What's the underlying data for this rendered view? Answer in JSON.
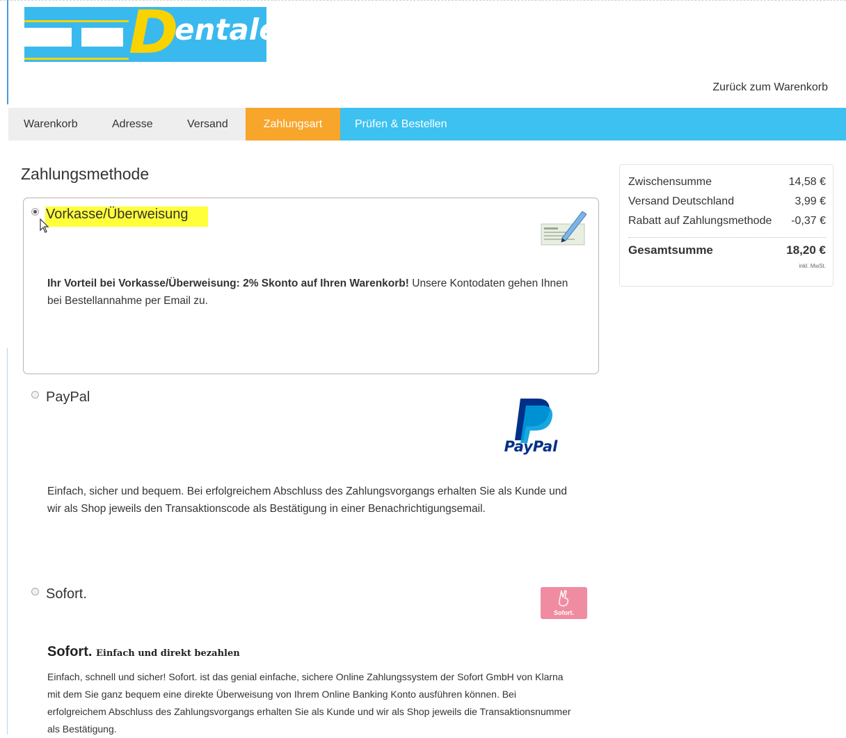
{
  "brand": {
    "logo_text": "Dentaler"
  },
  "header": {
    "back_link": "Zurück zum Warenkorb"
  },
  "steps": [
    {
      "label": "Warenkorb",
      "state": "done"
    },
    {
      "label": "Adresse",
      "state": "done"
    },
    {
      "label": "Versand",
      "state": "done"
    },
    {
      "label": "Zahlungsart",
      "state": "active"
    },
    {
      "label": "Prüfen & Bestellen",
      "state": "upcoming"
    }
  ],
  "main": {
    "heading": "Zahlungsmethode",
    "methods": [
      {
        "name": "Vorkasse/Überweisung",
        "selected": true,
        "icon": "bank-transfer-icon",
        "desc_bold": "Ihr Vorteil bei Vorkasse/Überweisung: 2% Skonto auf Ihren Warenkorb!",
        "desc": " Unsere Kontodaten gehen Ihnen bei Bestellannahme per Email zu."
      },
      {
        "name": "PayPal",
        "selected": false,
        "icon": "paypal-logo-icon",
        "logo_text": "PayPal",
        "desc": "Einfach, sicher und bequem. Bei erfolgreichem Abschluss des Zahlungsvorgangs erhalten Sie als Kunde und wir als Shop jeweils den Transaktionscode als Bestätigung in einer Benachrichtigungsemail."
      },
      {
        "name": "Sofort.",
        "selected": false,
        "icon": "sofort-logo-icon",
        "logo_text": "Sofort.",
        "title": "Sofort.",
        "subtitle": "Einfach und direkt bezahlen",
        "desc": "Einfach, schnell und sicher! Sofort. ist das genial einfache, sichere Online Zahlungssystem der Sofort GmbH von Klarna mit dem Sie ganz bequem eine direkte Überweisung von Ihrem Online Banking Konto ausführen können. Bei erfolgreichem Abschluss des Zahlungsvorgangs erhalten Sie als Kunde und wir als Shop jeweils die Transaktionsnummer als Bestätigung."
      }
    ]
  },
  "summary": {
    "rows": [
      {
        "label": "Zwischensumme",
        "value": "14,58 €"
      },
      {
        "label": "Versand Deutschland",
        "value": "3,99 €"
      },
      {
        "label": "Rabatt auf Zahlungsmethode",
        "value": "-0,37 €"
      }
    ],
    "total_label": "Gesamtsumme",
    "total_value": "18,20 €",
    "tax_note": "inkl. MwSt."
  },
  "colors": {
    "nav_bg": "#3cc1f0",
    "active_tab": "#f8a52b",
    "highlight": "#ffff3a",
    "paypal_dark": "#003087",
    "paypal_light": "#009cde",
    "sofort_pink": "#f08ca2"
  }
}
